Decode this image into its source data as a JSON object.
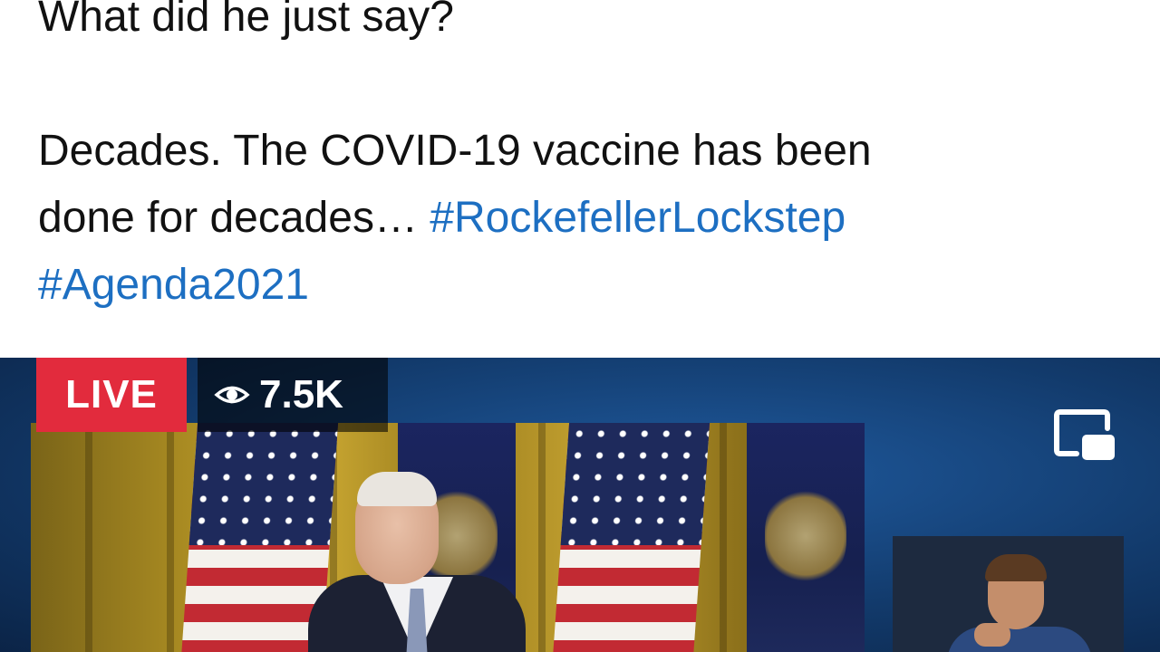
{
  "post": {
    "line1": "What did he just say?",
    "line2": "Decades. The COVID-19 vaccine has been",
    "line3_text": "done for decades… ",
    "hashtag1": "#RockefellerLockstep",
    "hashtag2": "#Agenda2021"
  },
  "video": {
    "live_label": "LIVE",
    "viewer_count": "7.5K",
    "icons": {
      "viewers": "eye-icon",
      "pip": "picture-in-picture-icon"
    }
  },
  "colors": {
    "hashtag": "#1d6fc2",
    "live_badge": "#e22b3d",
    "video_background": "#123a6b"
  }
}
